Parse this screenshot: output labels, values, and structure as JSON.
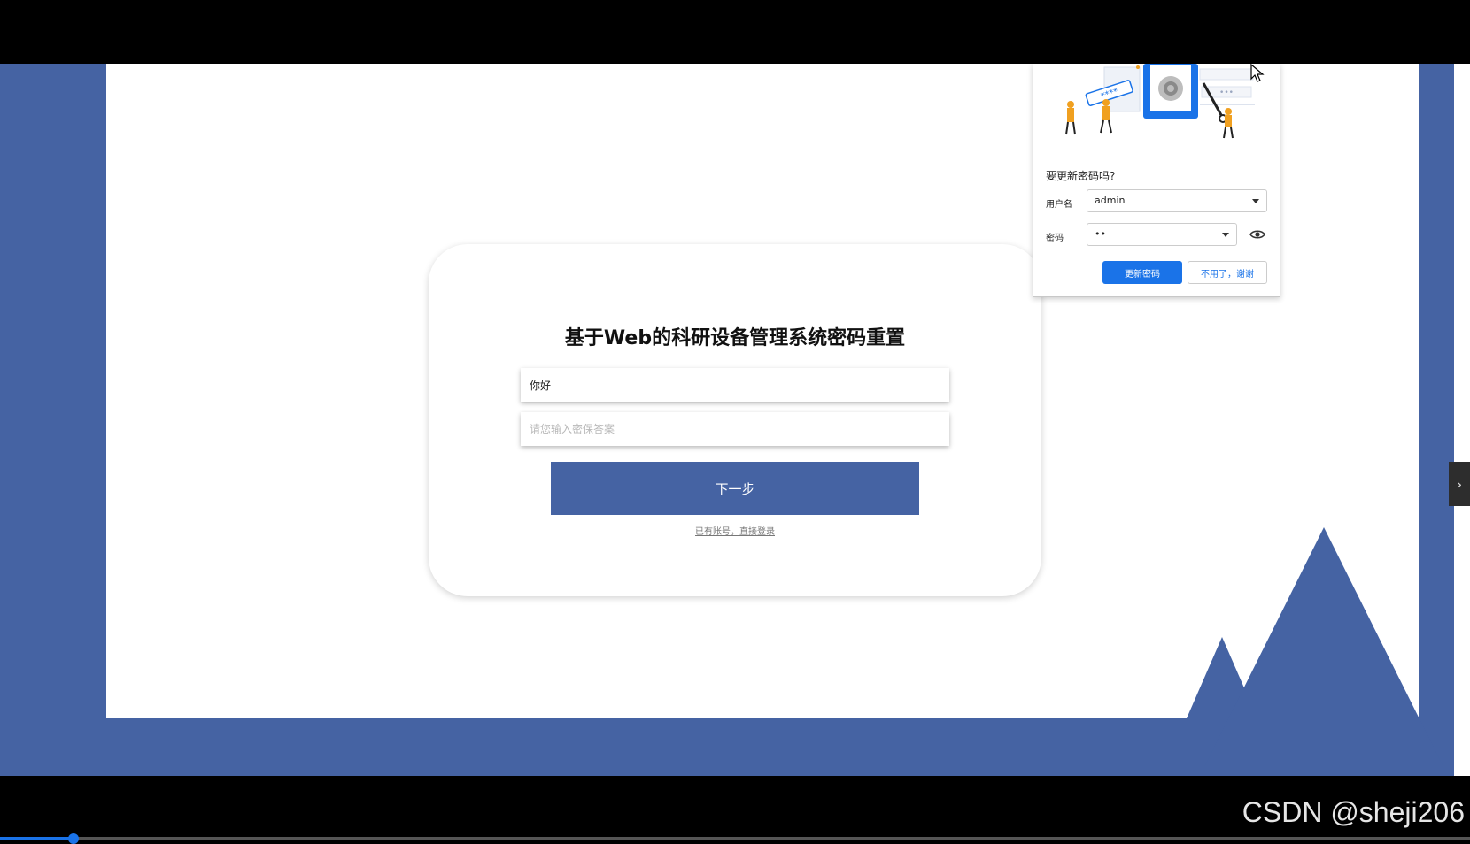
{
  "card": {
    "title": "基于Web的科研设备管理系统密码重置",
    "question_value": "你好",
    "answer_placeholder": "请您输入密保答案",
    "next_label": "下一步",
    "login_link": "已有账号，直接登录"
  },
  "password_popup": {
    "title": "要更新密码吗?",
    "username_label": "用户名",
    "username_value": "admin",
    "password_label": "密码",
    "password_value": "••",
    "update_label": "更新密码",
    "nothanks_label": "不用了，谢谢"
  },
  "illustration": {
    "stars_text": "****",
    "dots_text": "•••"
  },
  "side_tab": {
    "icon": "chevron-right-icon",
    "glyph": "›"
  },
  "watermark": "CSDN @sheji206",
  "video_progress": {
    "fraction": 0.05
  },
  "colors": {
    "brand_blue": "#4563a3",
    "chrome_blue": "#1a73e8",
    "figure_orange": "#f0a020"
  }
}
